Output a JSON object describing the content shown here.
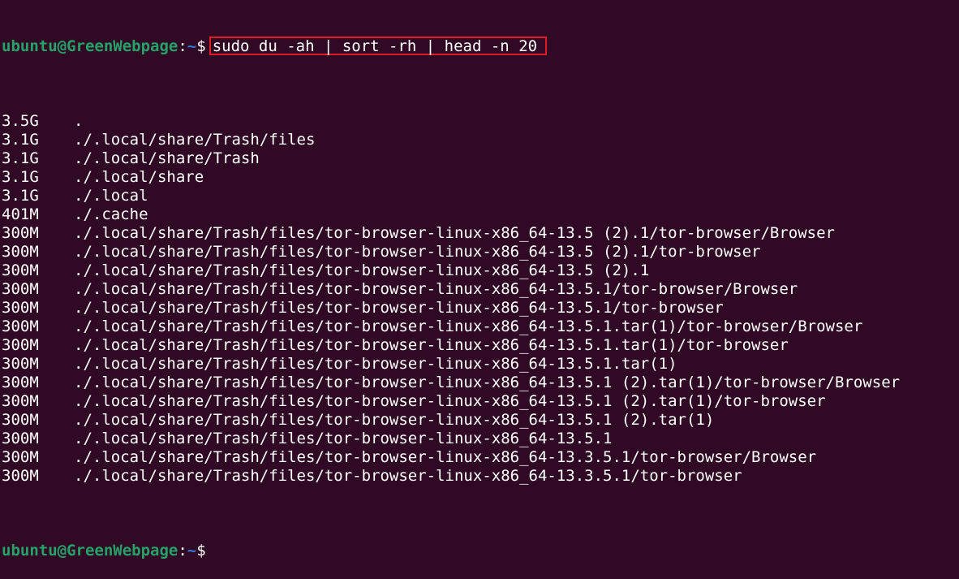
{
  "terminal": {
    "prompt": {
      "user_host": "ubuntu@GreenWebpage",
      "colon": ":",
      "dir": "~",
      "symbol": "$"
    },
    "command": "sudo du -ah | sort -rh | head -n 20",
    "highlight_color": "#e01b24",
    "background_color": "#300a24",
    "prompt_color": "#26a269",
    "output": [
      {
        "size": "3.5G",
        "path": "."
      },
      {
        "size": "3.1G",
        "path": "./.local/share/Trash/files"
      },
      {
        "size": "3.1G",
        "path": "./.local/share/Trash"
      },
      {
        "size": "3.1G",
        "path": "./.local/share"
      },
      {
        "size": "3.1G",
        "path": "./.local"
      },
      {
        "size": "401M",
        "path": "./.cache"
      },
      {
        "size": "300M",
        "path": "./.local/share/Trash/files/tor-browser-linux-x86_64-13.5 (2).1/tor-browser/Browser"
      },
      {
        "size": "300M",
        "path": "./.local/share/Trash/files/tor-browser-linux-x86_64-13.5 (2).1/tor-browser"
      },
      {
        "size": "300M",
        "path": "./.local/share/Trash/files/tor-browser-linux-x86_64-13.5 (2).1"
      },
      {
        "size": "300M",
        "path": "./.local/share/Trash/files/tor-browser-linux-x86_64-13.5.1/tor-browser/Browser"
      },
      {
        "size": "300M",
        "path": "./.local/share/Trash/files/tor-browser-linux-x86_64-13.5.1/tor-browser"
      },
      {
        "size": "300M",
        "path": "./.local/share/Trash/files/tor-browser-linux-x86_64-13.5.1.tar(1)/tor-browser/Browser"
      },
      {
        "size": "300M",
        "path": "./.local/share/Trash/files/tor-browser-linux-x86_64-13.5.1.tar(1)/tor-browser"
      },
      {
        "size": "300M",
        "path": "./.local/share/Trash/files/tor-browser-linux-x86_64-13.5.1.tar(1)"
      },
      {
        "size": "300M",
        "path": "./.local/share/Trash/files/tor-browser-linux-x86_64-13.5.1 (2).tar(1)/tor-browser/Browser"
      },
      {
        "size": "300M",
        "path": "./.local/share/Trash/files/tor-browser-linux-x86_64-13.5.1 (2).tar(1)/tor-browser"
      },
      {
        "size": "300M",
        "path": "./.local/share/Trash/files/tor-browser-linux-x86_64-13.5.1 (2).tar(1)"
      },
      {
        "size": "300M",
        "path": "./.local/share/Trash/files/tor-browser-linux-x86_64-13.5.1"
      },
      {
        "size": "300M",
        "path": "./.local/share/Trash/files/tor-browser-linux-x86_64-13.3.5.1/tor-browser/Browser"
      },
      {
        "size": "300M",
        "path": "./.local/share/Trash/files/tor-browser-linux-x86_64-13.3.5.1/tor-browser"
      }
    ]
  }
}
